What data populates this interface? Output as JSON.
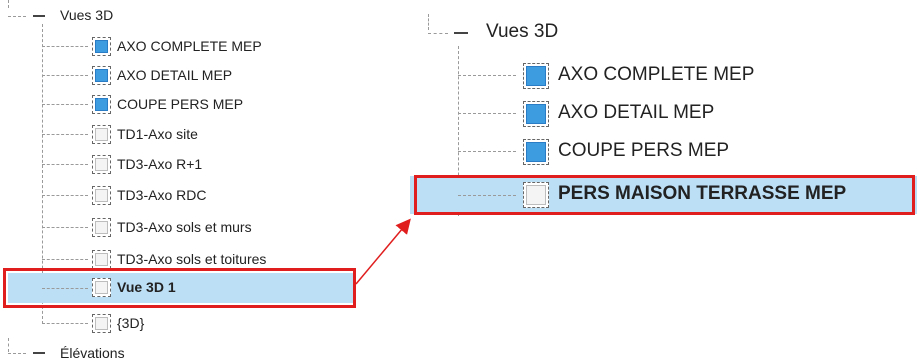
{
  "left_tree": {
    "group_label": "Vues 3D",
    "items": [
      {
        "label": "AXO COMPLETE MEP",
        "icon": "blue-3d-view-icon",
        "selected": false
      },
      {
        "label": "AXO DETAIL MEP",
        "icon": "blue-3d-view-icon",
        "selected": false
      },
      {
        "label": "COUPE PERS MEP",
        "icon": "blue-3d-view-icon",
        "selected": false
      },
      {
        "label": "TD1-Axo site",
        "icon": "white-3d-view-icon",
        "selected": false
      },
      {
        "label": "TD3-Axo R+1",
        "icon": "white-3d-view-icon",
        "selected": false
      },
      {
        "label": "TD3-Axo RDC",
        "icon": "white-3d-view-icon",
        "selected": false
      },
      {
        "label": "TD3-Axo sols et murs",
        "icon": "white-3d-view-icon",
        "selected": false
      },
      {
        "label": "TD3-Axo sols et toitures",
        "icon": "white-3d-view-icon",
        "selected": false
      },
      {
        "label": "Vue 3D 1",
        "icon": "white-3d-view-icon",
        "selected": true
      },
      {
        "label": "{3D}",
        "icon": "white-3d-view-icon",
        "selected": false
      }
    ],
    "next_group_label": "Élévations"
  },
  "right_tree": {
    "group_label": "Vues 3D",
    "items": [
      {
        "label": "AXO COMPLETE MEP",
        "icon": "blue-3d-view-icon",
        "selected": false
      },
      {
        "label": "AXO DETAIL MEP",
        "icon": "blue-3d-view-icon",
        "selected": false
      },
      {
        "label": "COUPE PERS MEP",
        "icon": "blue-3d-view-icon",
        "selected": false
      },
      {
        "label": "PERS MAISON TERRASSE MEP",
        "icon": "white-3d-view-icon",
        "selected": true
      }
    ]
  },
  "colors": {
    "highlight": "#bcdff5",
    "annotation_red": "#e01e1e",
    "view_icon_blue": "#3d9be0"
  }
}
